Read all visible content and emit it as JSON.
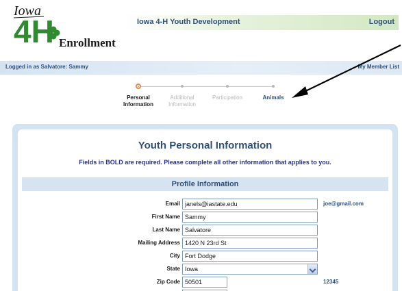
{
  "logo": {
    "line1": "Iowa",
    "line2": "4H",
    "line3": "Enrollment"
  },
  "header": {
    "title": "Iowa 4-H Youth Development",
    "logout": "Logout"
  },
  "userbar": {
    "logged_in": "Logged in as Salvatore: Sammy",
    "my_member_list": "My Member List"
  },
  "steps": [
    {
      "label": "Personal Information",
      "state": "active"
    },
    {
      "label": "Additional Information",
      "state": "inactive"
    },
    {
      "label": "Participation",
      "state": "inactive"
    },
    {
      "label": "Animals",
      "state": "link"
    }
  ],
  "page": {
    "title": "Youth Personal Information",
    "note": "Fields in BOLD are required. Please complete all other information that applies to you.",
    "section": "Profile Information"
  },
  "form": {
    "email": {
      "label": "Email",
      "value": "janels@iastate.edu",
      "hint": "joe@gmail.com"
    },
    "first_name": {
      "label": "First Name",
      "value": "Sammy"
    },
    "last_name": {
      "label": "Last Name",
      "value": "Salvatore"
    },
    "mailing_address": {
      "label": "Mailing Address",
      "value": "1420 N 23rd St"
    },
    "city": {
      "label": "City",
      "value": "Fort Dodge"
    },
    "state": {
      "label": "State",
      "value": "Iowa"
    },
    "zip": {
      "label": "Zip Code",
      "value": "50501",
      "hint": "12345"
    }
  },
  "colors": {
    "accent": "#2f4f7a",
    "logo_green": "#2e8b2e",
    "active_step": "#e88a4f",
    "note_blue": "#1e2fa0"
  }
}
